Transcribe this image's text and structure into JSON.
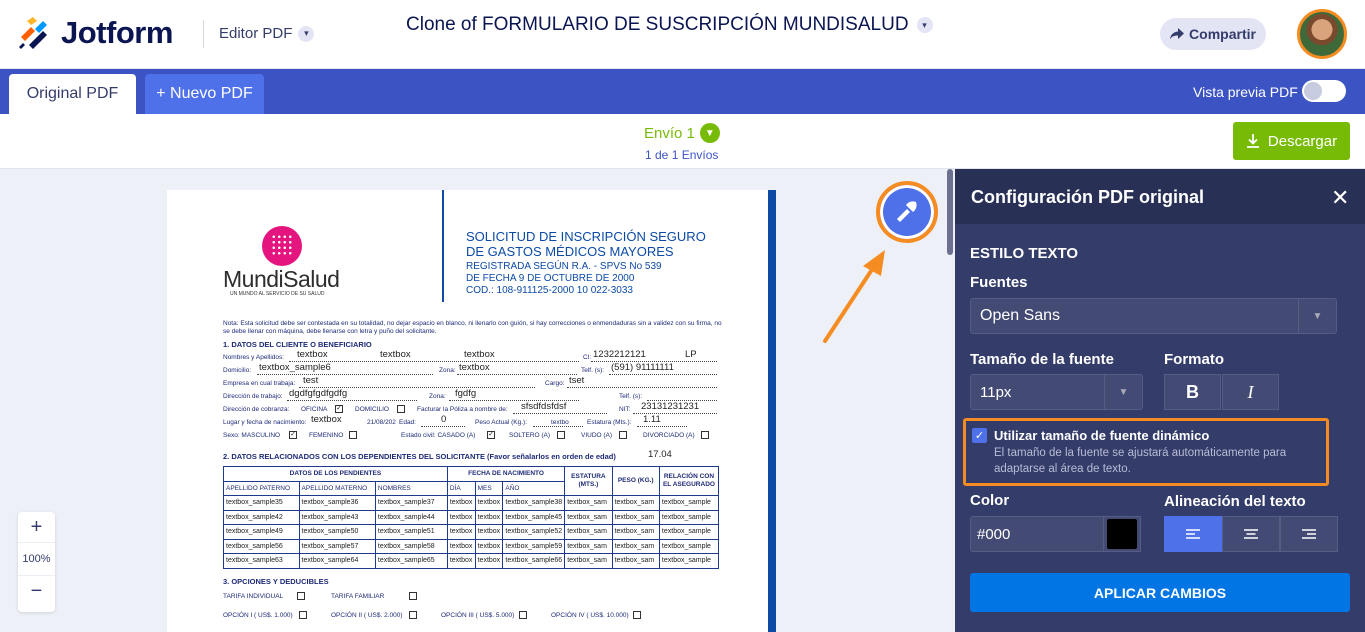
{
  "header": {
    "brand": "Jotform",
    "editor_label": "Editor PDF",
    "form_title": "Clone of FORMULARIO DE SUSCRIPCIÓN MUNDISALUD",
    "share_label": "Compartir"
  },
  "tabs": {
    "original": "Original PDF",
    "new": "+ Nuevo PDF",
    "preview_label": "Vista previa PDF",
    "preview_on": false
  },
  "submission": {
    "label": "Envío 1",
    "count": "1 de 1 Envíos",
    "download_label": "Descargar"
  },
  "zoom": {
    "plus": "+",
    "value": "100%",
    "minus": "−"
  },
  "pdf": {
    "brand": "MundiSalud",
    "brand_sub": "UN MUNDO AL SERVICIO DE SU SALUD",
    "title_lines": [
      "SOLICITUD DE INSCRIPCIÓN SEGURO",
      "DE GASTOS MÉDICOS MAYORES"
    ],
    "reg_lines": [
      "REGISTRADA SEGÚN R.A. - SPVS No 539",
      "DE FECHA 9 DE OCTUBRE DE 2000",
      "COD.: 108-911125-2000 10 022-3033"
    ],
    "note": "Nota: Esta solicitud debe ser contestada en su totalidad, no dejar espacio en blanco, ni llenarlo con guión, si hay correcciones o enmendaduras sin a validez con su firma, no se debe llenar con máquina, debe llenarse con letra y puño del solicitante.",
    "section1": "1. DATOS DEL CLIENTE O BENEFICIARIO",
    "section2": "2. DATOS RELACIONADOS CON LOS DEPENDIENTES DEL SOLICITANTE (Favor señalarlos en orden de edad)",
    "section3": "3. OPCIONES Y DEDUCIBLES",
    "labels": {
      "nombres": "Nombres y Apellidos:",
      "ci": "CI:",
      "domicilio": "Domicilio:",
      "zona": "Zona:",
      "telf": "Telf. (s):",
      "empresa": "Empresa en cual trabaja:",
      "cargo": "Cargo:",
      "dir_trabajo": "Dirección de trabajo:",
      "zona2": "Zona:",
      "telf2": "Telf. (s):",
      "dir_cobranza": "Dirección de cobranza:",
      "oficina": "OFICINA",
      "domicilio2": "DOMICILIO",
      "facturar": "Facturar la Póliza a nombre de:",
      "nit": "NIT:",
      "lugar": "Lugar y fecha de nacimiento:",
      "edad": "Edad:",
      "peso": "Peso Actual (Kg.):",
      "estatura": "Estatura (Mts.):",
      "sexo": "Sexo: MASCULINO",
      "femenino": "FEMENINO",
      "estado": "Estado civil: CASADO (A)",
      "soltero": "SOLTERO (A)",
      "viudo": "VIUDO (A)",
      "divorciado": "DIVORCIADO (A)",
      "tarifa_ind": "TARIFA INDIVIDUAL",
      "tarifa_fam": "TARIFA FAMILIAR",
      "op1": "OPCIÓN I ( US$. 1.000)",
      "op2": "OPCIÓN II ( US$. 2.000)",
      "op3": "OPCIÓN III ( US$. 5.000)",
      "op4": "OPCIÓN IV ( US$. 10.000)"
    },
    "values": {
      "nombre1": "textbox",
      "nombre2": "textbox",
      "nombre3": "textbox",
      "ci": "1232212121",
      "ci_ext": "LP",
      "domicilio": "textbox_sample6",
      "zona": "textbox",
      "telf": "(591) 91111111",
      "empresa": "test",
      "cargo": "tset",
      "dir_trabajo": "dgdfgfgdfgdfg",
      "zona2": "fgdfg",
      "facturar": "sfsdfdsfdsf",
      "nit": "23131231231",
      "lugar": "textbox",
      "fecha": "21/08/202",
      "edad": "0",
      "peso": "textbo",
      "estatura": "1.11",
      "age": "17.04",
      "check": "✓"
    },
    "table": {
      "group_headers": [
        "DATOS DE LOS PENDIENTES",
        "FECHA DE NACIMIENTO",
        "ESTATURA (MTS.)",
        "PESO (KG.)",
        "RELACIÓN CON EL ASEGURADO"
      ],
      "sub_headers": [
        "APELLIDO PATERNO",
        "APELLIDO MATERNO",
        "NOMBRES",
        "DÍA",
        "MES",
        "AÑO"
      ],
      "rows": [
        [
          "textbox_sample35",
          "textbox_sample36",
          "textbox_sample37",
          "textbox",
          "textbox",
          "textbox_sample38",
          "textbox_sam",
          "textbox_sam",
          "textbox_sample"
        ],
        [
          "textbox_sample42",
          "textbox_sample43",
          "textbox_sample44",
          "textbox",
          "textbox",
          "textbox_sample45",
          "textbox_sam",
          "textbox_sam",
          "textbox_sample"
        ],
        [
          "textbox_sample49",
          "textbox_sample50",
          "textbox_sample51",
          "textbox",
          "textbox",
          "textbox_sample52",
          "textbox_sam",
          "textbox_sam",
          "textbox_sample"
        ],
        [
          "textbox_sample56",
          "textbox_sample57",
          "textbox_sample58",
          "textbox",
          "textbox",
          "textbox_sample59",
          "textbox_sam",
          "textbox_sam",
          "textbox_sample"
        ],
        [
          "textbox_sample63",
          "textbox_sample64",
          "textbox_sample65",
          "textbox",
          "textbox",
          "textbox_sample66",
          "textbox_sam",
          "textbox_sam",
          "textbox_sample"
        ]
      ]
    }
  },
  "panel": {
    "title": "Configuración PDF original",
    "section": "ESTILO TEXTO",
    "font_label": "Fuentes",
    "font_value": "Open Sans",
    "size_label": "Tamaño de la fuente",
    "size_value": "11px",
    "format_label": "Formato",
    "bold": "B",
    "italic": "I",
    "dynamic_title": "Utilizar tamaño de fuente dinámico",
    "dynamic_desc": "El tamaño de la fuente se ajustará automáticamente para adaptarse al área de texto.",
    "dynamic_checked": true,
    "color_label": "Color",
    "color_value": "#000",
    "align_label": "Alineación del texto",
    "apply_label": "APLICAR CAMBIOS"
  },
  "colors": {
    "brand_blue": "#3c53c4",
    "accent_green": "#78bb07",
    "panel_bg": "#343c6a",
    "highlight_orange": "#f58c22",
    "apply_blue": "#0075e3"
  },
  "icons": {
    "logo": "jotform-logo-icon",
    "share": "share-arrow-icon",
    "download": "download-icon",
    "rocket": "pdf-settings-brush-icon",
    "close": "close-icon",
    "caret": "chevron-down-icon"
  }
}
